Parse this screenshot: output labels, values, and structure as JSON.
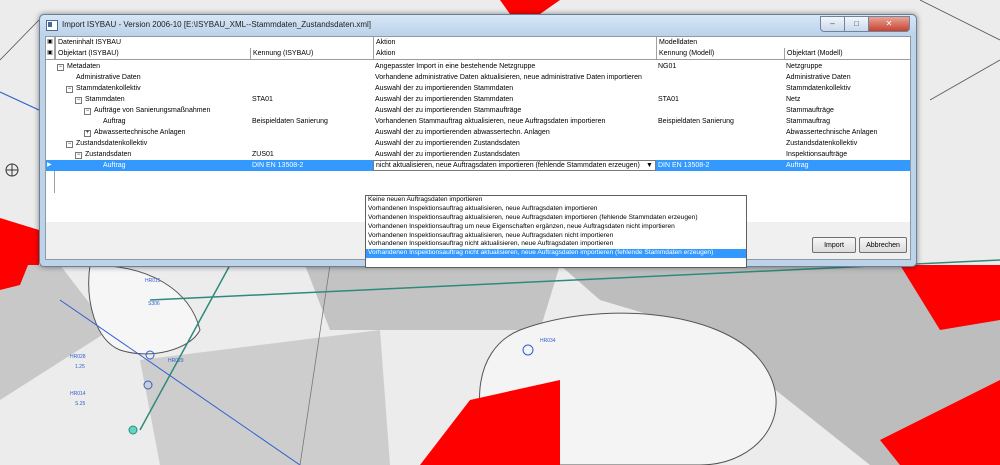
{
  "window": {
    "title": "Import ISYBAU  - Version 2006-10 [E:\\ISYBAU_XML--Stammdaten_Zustandsdaten.xml]",
    "min_glyph": "–",
    "max_glyph": "□",
    "close_glyph": "✕"
  },
  "grid": {
    "groups": [
      "Dateninhalt ISYBAU",
      "Aktion",
      "Modelldaten"
    ],
    "columns": [
      "Objektart (ISYBAU)",
      "Kennung (ISYBAU)",
      "Aktion",
      "Kennung (Modell)",
      "Objektart (Modell)"
    ],
    "rows": [
      {
        "indent": 0,
        "expander": "−",
        "objektart": "Metadaten",
        "kennung": "",
        "aktion": "Angepasster Import in eine bestehende Netzgruppe",
        "kennung_modell": "NG01",
        "objektart_modell": "Netzgruppe"
      },
      {
        "indent": 1,
        "expander": "",
        "objektart": "Administrative Daten",
        "kennung": "",
        "aktion": "Vorhandene administrative Daten aktualisieren, neue administrative Daten importieren",
        "kennung_modell": "",
        "objektart_modell": "Administrative Daten"
      },
      {
        "indent": 1,
        "expander": "−",
        "objektart": "Stammdatenkollektiv",
        "kennung": "",
        "aktion": "Auswahl der zu importierenden Stammdaten",
        "kennung_modell": "",
        "objektart_modell": "Stammdatenkollektiv"
      },
      {
        "indent": 2,
        "expander": "−",
        "objektart": "Stammdaten",
        "kennung": "STA01",
        "aktion": "Auswahl der zu importierenden Stammdaten",
        "kennung_modell": "STA01",
        "objektart_modell": "Netz"
      },
      {
        "indent": 3,
        "expander": "−",
        "objektart": "Aufträge von Sanierungsmaßnahmen",
        "kennung": "",
        "aktion": "Auswahl der zu importierenden Stammaufträge",
        "kennung_modell": "",
        "objektart_modell": "Stammaufträge"
      },
      {
        "indent": 4,
        "expander": "",
        "objektart": "Auftrag",
        "kennung": "Beispieldaten Sanierung",
        "aktion": "Vorhandenen Stammauftrag aktualisieren, neue Auftragsdaten importieren",
        "kennung_modell": "Beispieldaten Sanierung",
        "objektart_modell": "Stammauftrag"
      },
      {
        "indent": 3,
        "expander": "+",
        "objektart": "Abwassertechnische Anlagen",
        "kennung": "",
        "aktion": "Auswahl der zu importierenden abwassertechn. Anlagen",
        "kennung_modell": "",
        "objektart_modell": "Abwassertechnische Anlagen"
      },
      {
        "indent": 1,
        "expander": "−",
        "objektart": "Zustandsdatenkollektiv",
        "kennung": "",
        "aktion": "Auswahl der zu importierenden Zustandsdaten",
        "kennung_modell": "",
        "objektart_modell": "Zustandsdatenkollektiv"
      },
      {
        "indent": 2,
        "expander": "−",
        "objektart": "Zustandsdaten",
        "kennung": "ZUS01",
        "aktion": "Auswahl der zu importierenden Zustandsdaten",
        "kennung_modell": "",
        "objektart_modell": "Inspektionsaufträge"
      },
      {
        "indent": 4,
        "expander": "",
        "objektart": "Auftrag",
        "kennung": "DIN EN 13508-2",
        "aktion": "nicht aktualisieren, neue Auftragsdaten importieren (fehlende Stammdaten erzeugen)",
        "kennung_modell": "DIN EN 13508-2",
        "objektart_modell": "Auftrag",
        "selected": true
      }
    ],
    "row_indicator": "▶"
  },
  "dropdown": {
    "options": [
      "Keine neuen Auftragsdaten importieren",
      "Vorhandenen Inspektionsauftrag aktualisieren, neue Auftragsdaten importieren",
      "Vorhandenen Inspektionsauftrag aktualisieren, neue Auftragsdaten importieren (fehlende Stammdaten erzeugen)",
      "Vorhandenen Inspektionsauftrag um neue Eigenschaften ergänzen, neue Auftragsdaten nicht importieren",
      "Vorhandenen Inspektionsauftrag aktualisieren, neue Auftragsdaten nicht importieren",
      "Vorhandenen Inspektionsauftrag nicht aktualisieren, neue Auftragsdaten importieren",
      "Vorhandenen Inspektionsauftrag nicht aktualisieren, neue Auftragsdaten importieren (fehlende Stammdaten erzeugen)"
    ],
    "highlighted_index": 6
  },
  "buttons": {
    "import": "Import",
    "cancel": "Abbrechen"
  },
  "cad": {
    "labels": [
      "HR028",
      "HR029",
      "HR014",
      "HR015",
      "HR034",
      "S306",
      "1.25",
      "S.25"
    ],
    "colors": {
      "red": "#ff0000",
      "gray": "#c3c3c3",
      "line_blue": "#2f5fd0",
      "line_green": "#2f8a7a"
    }
  }
}
